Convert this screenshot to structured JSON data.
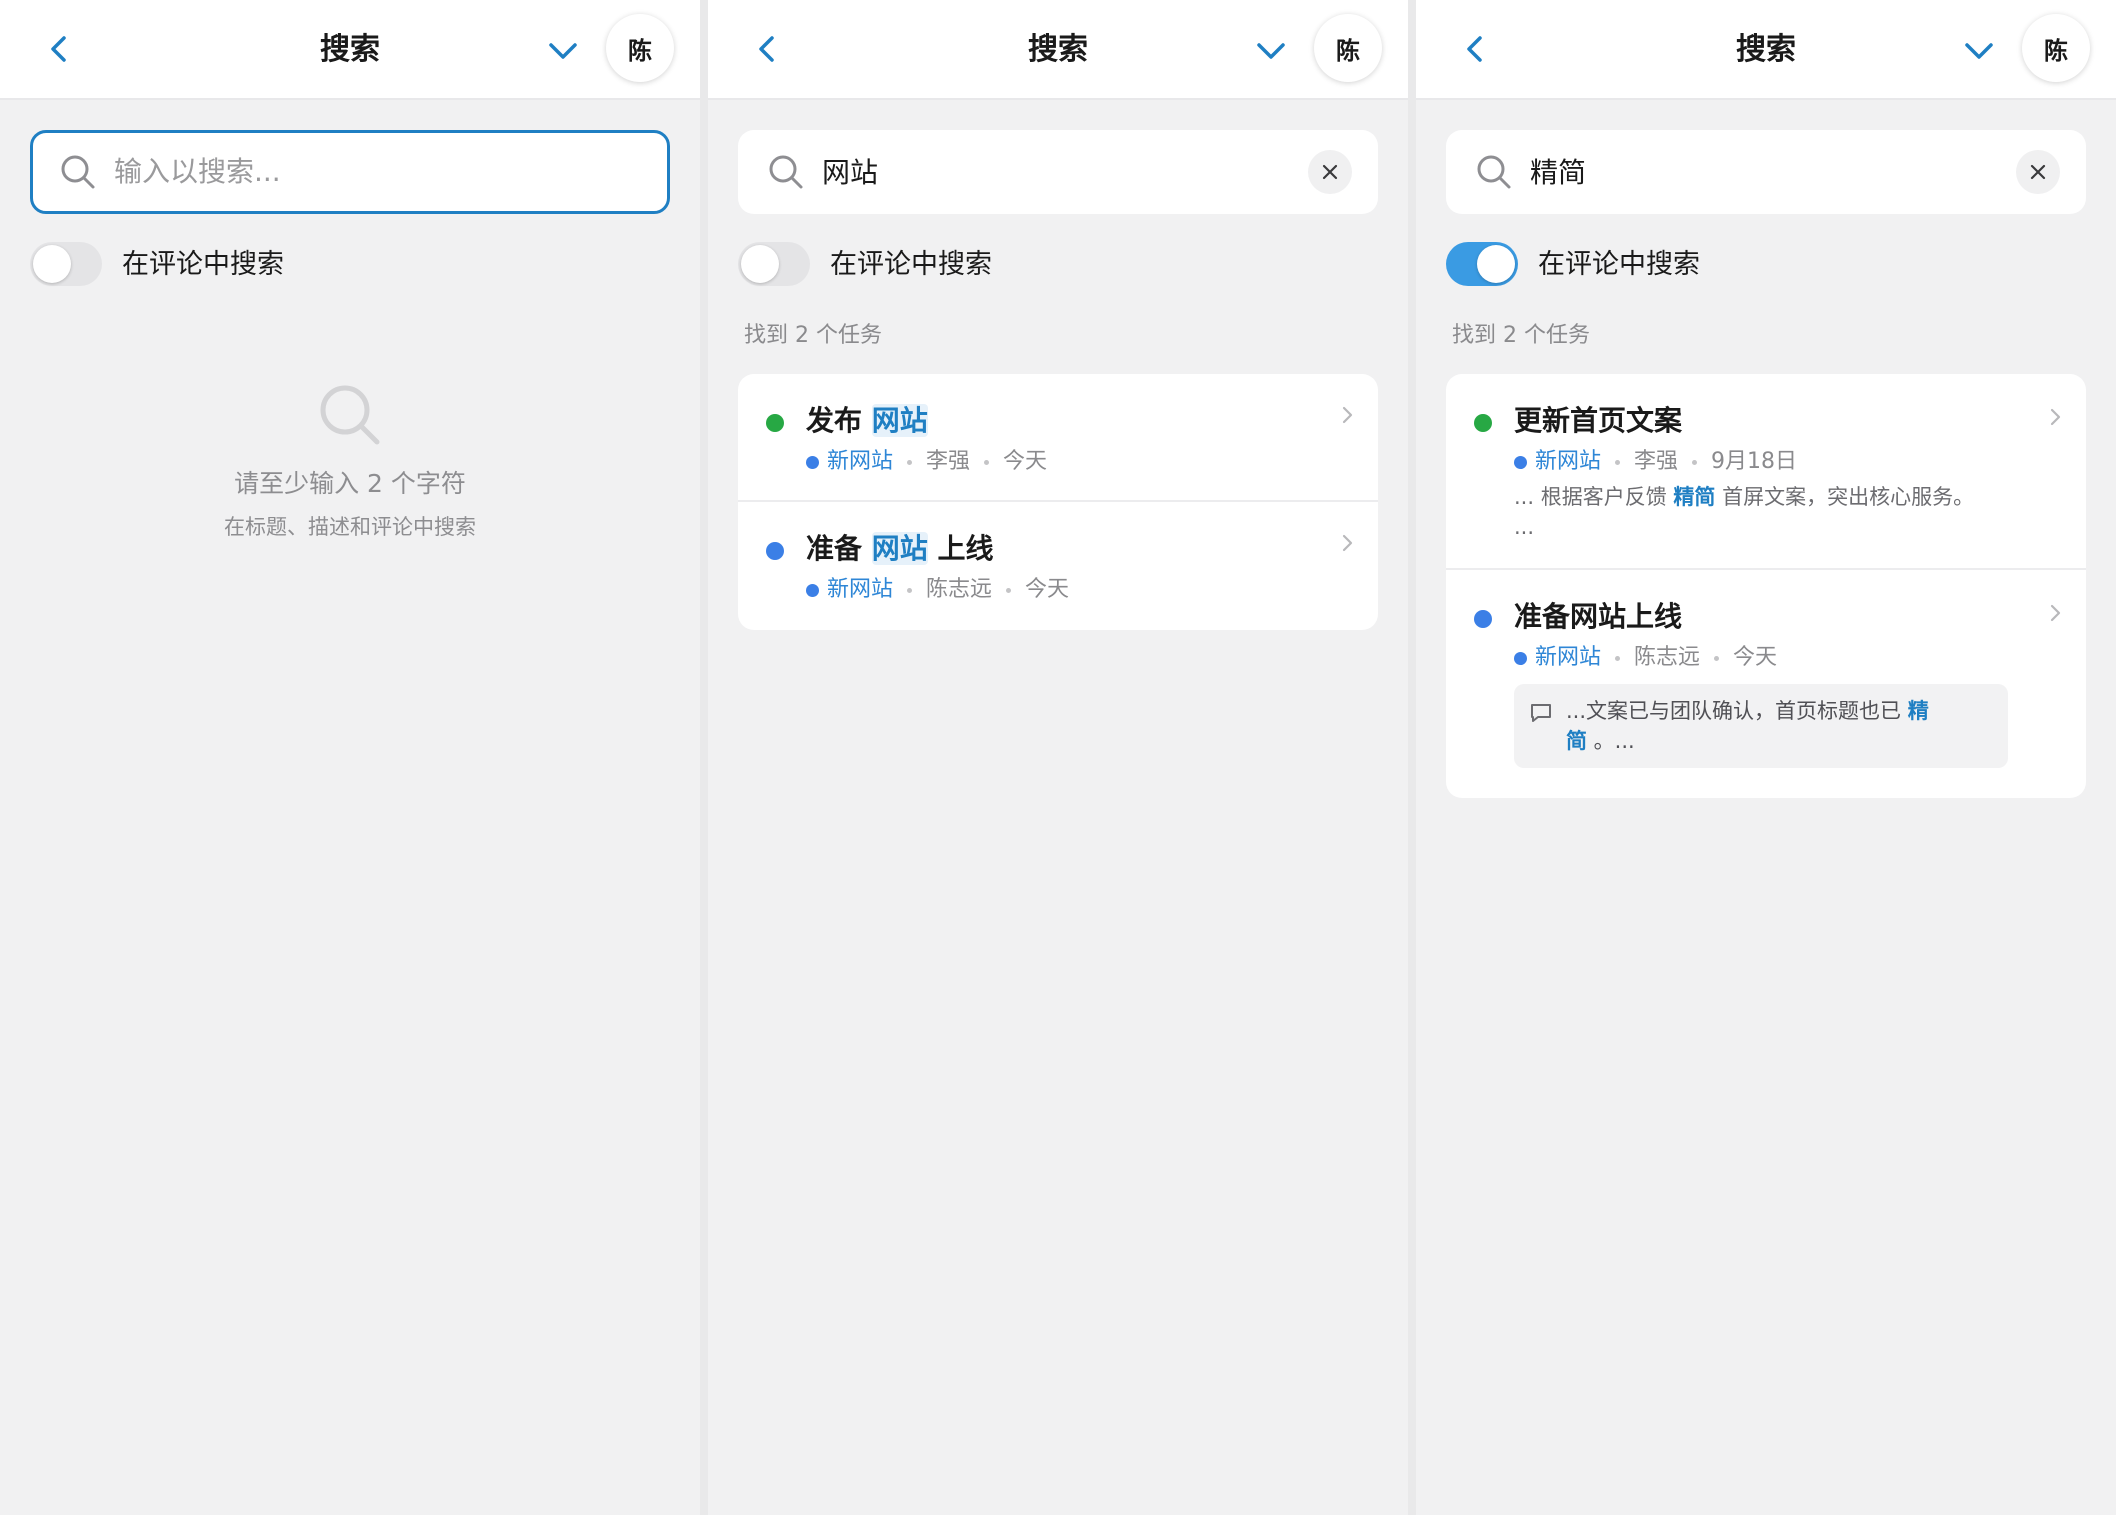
{
  "panels": [
    {
      "header": {
        "title": "搜索",
        "avatar": "陈"
      },
      "search": {
        "value": "",
        "placeholder": "输入以搜索..."
      },
      "toggle": {
        "label": "在评论中搜索",
        "on": false
      },
      "empty_state": {
        "title": "请至少输入 2 个字符",
        "subtitle": "在标题、描述和评论中搜索"
      }
    },
    {
      "header": {
        "title": "搜索",
        "avatar": "陈"
      },
      "search": {
        "value": "网站",
        "placeholder": "输入以搜索..."
      },
      "toggle": {
        "label": "在评论中搜索",
        "on": false
      },
      "results_count": "找到 2 个任务",
      "results": [
        {
          "title_before": "发布 ",
          "title_match": "网站",
          "title_after": "",
          "status_color": "#27a844",
          "project": "新网站",
          "assignee": "李强",
          "date": "今天"
        },
        {
          "title_before": "准备 ",
          "title_match": "网站",
          "title_after": " 上线",
          "status_color": "#3b7fe6",
          "project": "新网站",
          "assignee": "陈志远",
          "date": "今天"
        }
      ]
    },
    {
      "header": {
        "title": "搜索",
        "avatar": "陈"
      },
      "search": {
        "value": "精简",
        "placeholder": "输入以搜索..."
      },
      "toggle": {
        "label": "在评论中搜索",
        "on": true
      },
      "results_count": "找到 2 个任务",
      "results": [
        {
          "title": "更新首页文案",
          "status_color": "#27a844",
          "project": "新网站",
          "assignee": "李强",
          "date": "9月18日",
          "snippet_before": "... 根据客户反馈 ",
          "snippet_match": "精简",
          "snippet_after": " 首屏文案，突出核心服务。",
          "snippet_ellipsis": "..."
        },
        {
          "title": "准备网站上线",
          "status_color": "#3b7fe6",
          "project": "新网站",
          "assignee": "陈志远",
          "date": "今天",
          "comment_before": "...文案已与团队确认，首页标题也已 ",
          "comment_match_1": "精",
          "comment_match_2": "简",
          "comment_after": " 。..."
        }
      ]
    }
  ],
  "colors": {
    "accent": "#1f7fc3",
    "project_dot": "#3b7fe6",
    "toggle_on": "#3a9be3",
    "status_green": "#27a844",
    "status_blue": "#3b7fe6"
  },
  "icons": [
    "chevron-left-icon",
    "chevron-down-icon",
    "search-icon",
    "close-icon",
    "chevron-right-icon",
    "comment-icon"
  ]
}
